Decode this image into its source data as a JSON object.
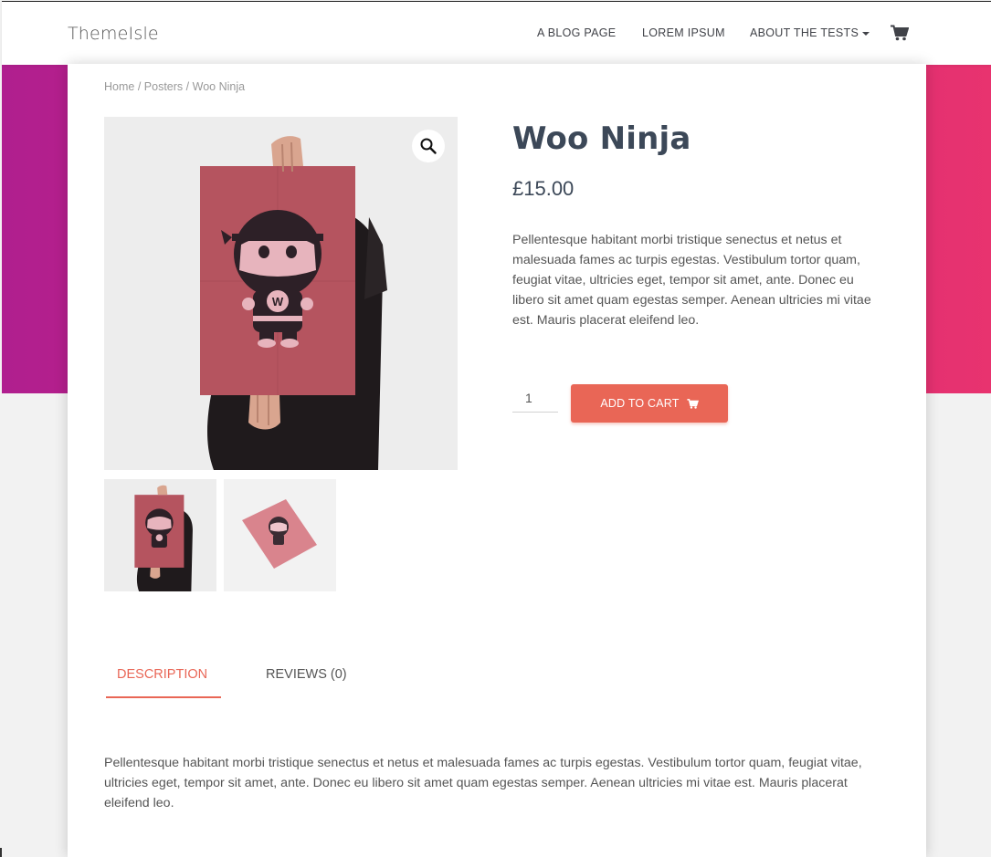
{
  "site": {
    "brand": "ThemeIsle"
  },
  "nav": {
    "items": [
      {
        "label": "A BLOG PAGE"
      },
      {
        "label": "LOREM IPSUM"
      },
      {
        "label": "ABOUT THE TESTS"
      }
    ],
    "cart_icon": "shopping-cart-icon"
  },
  "breadcrumb": {
    "home": "Home",
    "category": "Posters",
    "current": "Woo Ninja",
    "separator": "/"
  },
  "product": {
    "title": "Woo Ninja",
    "price": "£15.00",
    "short_description": "Pellentesque habitant morbi tristique senectus et netus et malesuada fames ac turpis egestas. Vestibulum tortor quam, feugiat vitae, ultricies eget, tempor sit amet, ante. Donec eu libero sit amet quam egestas semper. Aenean ultricies mi vitae est. Mauris placerat eleifend leo.",
    "quantity": "1",
    "add_to_cart_label": "ADD TO CART",
    "poster_letter": "W"
  },
  "tabs": [
    {
      "label": "DESCRIPTION",
      "active": true
    },
    {
      "label": "REVIEWS (0)",
      "active": false
    }
  ],
  "description": "Pellentesque habitant morbi tristique senectus et netus et malesuada fames ac turpis egestas. Vestibulum tortor quam, feugiat vitae, ultricies eget, tempor sit amet, ante. Donec eu libero sit amet quam egestas semper. Aenean ultricies mi vitae est. Mauris placerat eleifend leo.",
  "colors": {
    "accent": "#e96656",
    "gradient_start": "#b01f8f",
    "gradient_end": "#e8336f",
    "title": "#3c4858",
    "poster": "#b5545f"
  }
}
